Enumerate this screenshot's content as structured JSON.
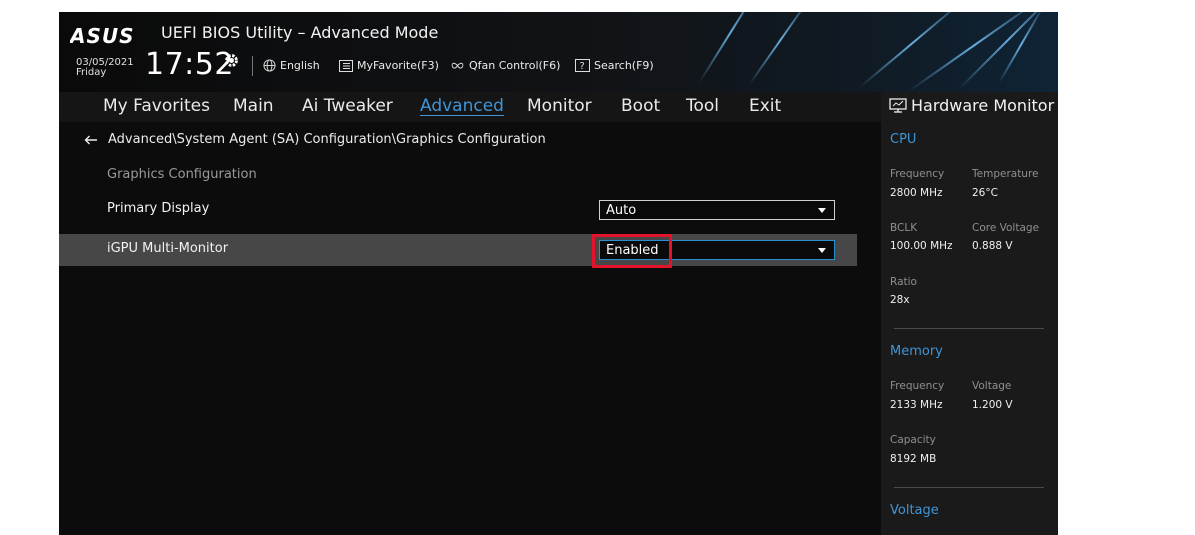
{
  "header": {
    "brand": "ASUS",
    "title": "UEFI BIOS Utility – Advanced Mode",
    "date": "03/05/2021",
    "weekday": "Friday",
    "time": "17:52",
    "tools": {
      "language": "English",
      "myfavorite": "MyFavorite(F3)",
      "qfan": "Qfan Control(F6)",
      "search": "Search(F9)"
    }
  },
  "menu": {
    "tabs": [
      "My Favorites",
      "Main",
      "Ai Tweaker",
      "Advanced",
      "Monitor",
      "Boot",
      "Tool",
      "Exit"
    ],
    "active": "Advanced"
  },
  "main": {
    "breadcrumb": "Advanced\\System Agent (SA) Configuration\\Graphics Configuration",
    "section_title": "Graphics Configuration",
    "settings": [
      {
        "label": "Primary Display",
        "value": "Auto"
      },
      {
        "label": "iGPU Multi-Monitor",
        "value": "Enabled"
      }
    ]
  },
  "hardware_monitor": {
    "title": "Hardware Monitor",
    "cpu": {
      "heading": "CPU",
      "frequency_label": "Frequency",
      "frequency": "2800 MHz",
      "temperature_label": "Temperature",
      "temperature": "26°C",
      "bclk_label": "BCLK",
      "bclk": "100.00 MHz",
      "core_voltage_label": "Core Voltage",
      "core_voltage": "0.888 V",
      "ratio_label": "Ratio",
      "ratio": "28x"
    },
    "memory": {
      "heading": "Memory",
      "frequency_label": "Frequency",
      "frequency": "2133 MHz",
      "voltage_label": "Voltage",
      "voltage": "1.200 V",
      "capacity_label": "Capacity",
      "capacity": "8192 MB"
    },
    "voltage": {
      "heading": "Voltage"
    }
  },
  "colors": {
    "accent": "#3f95d6",
    "highlight": "#e2132b",
    "selected_row": "#474747"
  }
}
